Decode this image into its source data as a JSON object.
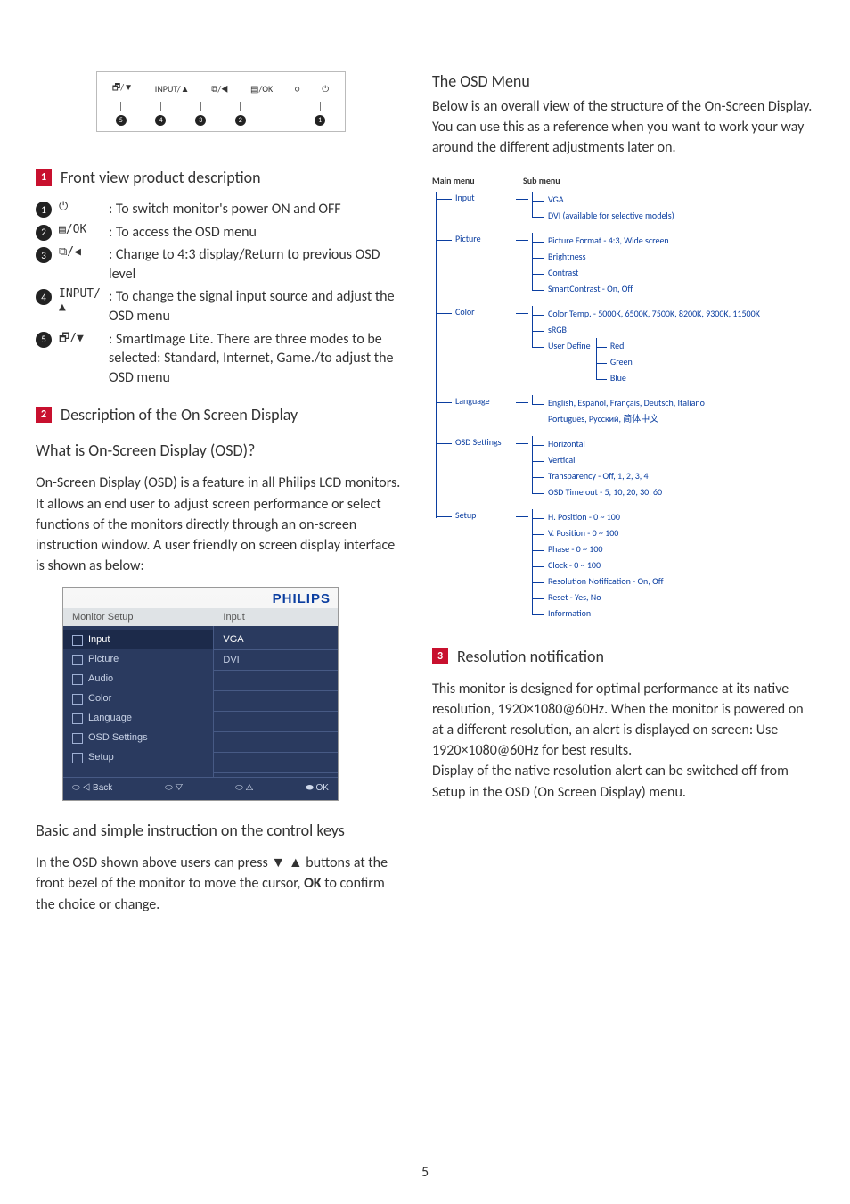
{
  "page_number": "5",
  "panel_labels": [
    "🗗/▼",
    "INPUT/▲",
    "⧉/◀",
    "▤/OK",
    "○",
    "⏻"
  ],
  "panel_nums": [
    "5",
    "4",
    "3",
    "2",
    "1"
  ],
  "sec1": {
    "num": "1",
    "title": "Front view product description",
    "items": [
      {
        "n": "1",
        "icon": "⏻",
        "desc": ": To switch monitor's power ON and OFF"
      },
      {
        "n": "2",
        "icon": "▤/OK",
        "desc": ": To access the OSD menu"
      },
      {
        "n": "3",
        "icon": "⧉/◀",
        "desc": ": Change to 4:3 display/Return to previous OSD level"
      },
      {
        "n": "4",
        "icon": "INPUT/▲",
        "desc": ": To change the signal input source and adjust the OSD menu"
      },
      {
        "n": "5",
        "icon": "🗗/▼",
        "desc": ": SmartImage Lite. There are three modes to be selected: Standard, Internet, Game./to adjust the OSD menu"
      }
    ]
  },
  "sec2": {
    "num": "2",
    "title": "Description of the On Screen Display",
    "q": "What is On-Screen Display (OSD)?",
    "p1": "On-Screen Display (OSD) is a feature in all Philips LCD monitors. It allows an end user to adjust screen performance or select functions of the monitors directly through an on-screen instruction window. A user friendly on screen display interface is shown as below:",
    "basic_h": "Basic and simple instruction on the control keys",
    "p2a": "In the OSD shown above users can press ▼ ▲ buttons at the front bezel of the monitor to move the cursor, ",
    "p2_ok": "OK",
    "p2b": " to confirm the choice or change."
  },
  "osd": {
    "brand": "PHILIPS",
    "h1": "Monitor Setup",
    "h2": "Input",
    "left": [
      "Input",
      "Picture",
      "Audio",
      "Color",
      "Language",
      "OSD Settings",
      "Setup"
    ],
    "right": [
      "VGA",
      "DVI"
    ],
    "foot": [
      "◁ Back",
      "▽",
      "△",
      "OK"
    ]
  },
  "r1": {
    "title": "The OSD Menu",
    "p": "Below is an overall view of the structure of the On-Screen Display. You can use this as a reference when you want to work your way around the different adjustments later on."
  },
  "tree_h": {
    "main": "Main menu",
    "sub": "Sub menu"
  },
  "tree": {
    "input": {
      "label": "Input",
      "subs": [
        "VGA",
        "DVI (available for selective models)"
      ]
    },
    "picture": {
      "label": "Picture",
      "subs": [
        "Picture Format  - 4:3, Wide screen",
        "Brightness",
        "Contrast",
        "SmartContrast - On, Off"
      ]
    },
    "color": {
      "label": "Color",
      "subs": [
        "Color Temp.   - 5000K, 6500K, 7500K, 8200K, 9300K, 11500K",
        "sRGB",
        "User Define"
      ],
      "userdef": [
        "Red",
        "Green",
        "Blue"
      ]
    },
    "language": {
      "label": "Language",
      "line1": "English, Español, Français, Deutsch, Italiano",
      "line2": "Português, Русский, 简体中文"
    },
    "osds": {
      "label": "OSD Settings",
      "subs": [
        "Horizontal",
        "Vertical",
        "Transparency  - Off, 1, 2, 3, 4",
        "OSD Time out - 5, 10, 20, 30, 60"
      ]
    },
    "setup": {
      "label": "Setup",
      "subs": [
        "H. Position       - 0 ~ 100",
        "V. Position       - 0 ~ 100",
        "Phase             - 0 ~ 100",
        "Clock              - 0 ~ 100",
        "Resolution Notification  - On, Off",
        "Reset              - Yes, No",
        "Information"
      ]
    }
  },
  "sec3": {
    "num": "3",
    "title": "Resolution notification",
    "p": "This monitor is designed for optimal performance at its native resolution, 1920×1080@60Hz. When the monitor is powered on at a different resolution, an alert is displayed on screen: Use 1920×1080@60Hz for best results.\nDisplay of the native resolution alert can be switched off from Setup in the OSD (On Screen Display) menu."
  }
}
